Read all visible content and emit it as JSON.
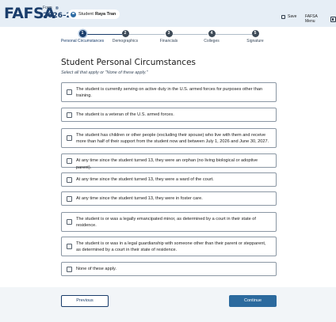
{
  "header": {
    "logo_text": "FAFSA",
    "logo_mark": "®",
    "form_label": "Form",
    "form_year": "2026–27",
    "student_role": "Student",
    "student_name": "Raya Tran",
    "save_label": "Save",
    "menu_label": "FAFSA Menu"
  },
  "stepper": {
    "steps": [
      {
        "number": "1",
        "label": "Personal Circumstances",
        "active": true
      },
      {
        "number": "2",
        "label": "Demographics",
        "active": false
      },
      {
        "number": "3",
        "label": "Financials",
        "active": false
      },
      {
        "number": "4",
        "label": "Colleges",
        "active": false
      },
      {
        "number": "5",
        "label": "Signature",
        "active": false
      }
    ]
  },
  "main": {
    "title": "Student Personal Circumstances",
    "instructions": "Select all that apply or \"None of these apply.\"",
    "options": [
      {
        "text": "The student is currently serving on active duty in the U.S. armed forces for purposes other than training.",
        "checked": false
      },
      {
        "text": "The student is a veteran of the U.S. armed forces.",
        "checked": false
      },
      {
        "text": "The student has children or other people (excluding their spouse) who live with them and receive more than half of their support from the student now and between July 1, 2026 and June 30, 2027.",
        "checked": false
      },
      {
        "text": "At any time since the student turned 13, they were an orphan (no living biological or adoptive parent).",
        "checked": false
      },
      {
        "text": "At any time since the student turned 13, they were a ward of the court.",
        "checked": false
      },
      {
        "text": "At any time since the student turned 13, they were in foster care.",
        "checked": false
      },
      {
        "text": "The student is or was a legally emancipated minor, as determined by a court in their state of residence.",
        "checked": false
      },
      {
        "text": "The student is or was in a legal guardianship with someone other than their parent or stepparent, as determined by a court in their state of residence.",
        "checked": false
      },
      {
        "text": "None of these apply.",
        "checked": false
      }
    ]
  },
  "footer": {
    "previous_label": "Previous",
    "continue_label": "Continue"
  },
  "colors": {
    "brand_navy": "#1a3d6b",
    "continue_blue": "#2c6a9e",
    "header_bg": "#e6eef6"
  }
}
